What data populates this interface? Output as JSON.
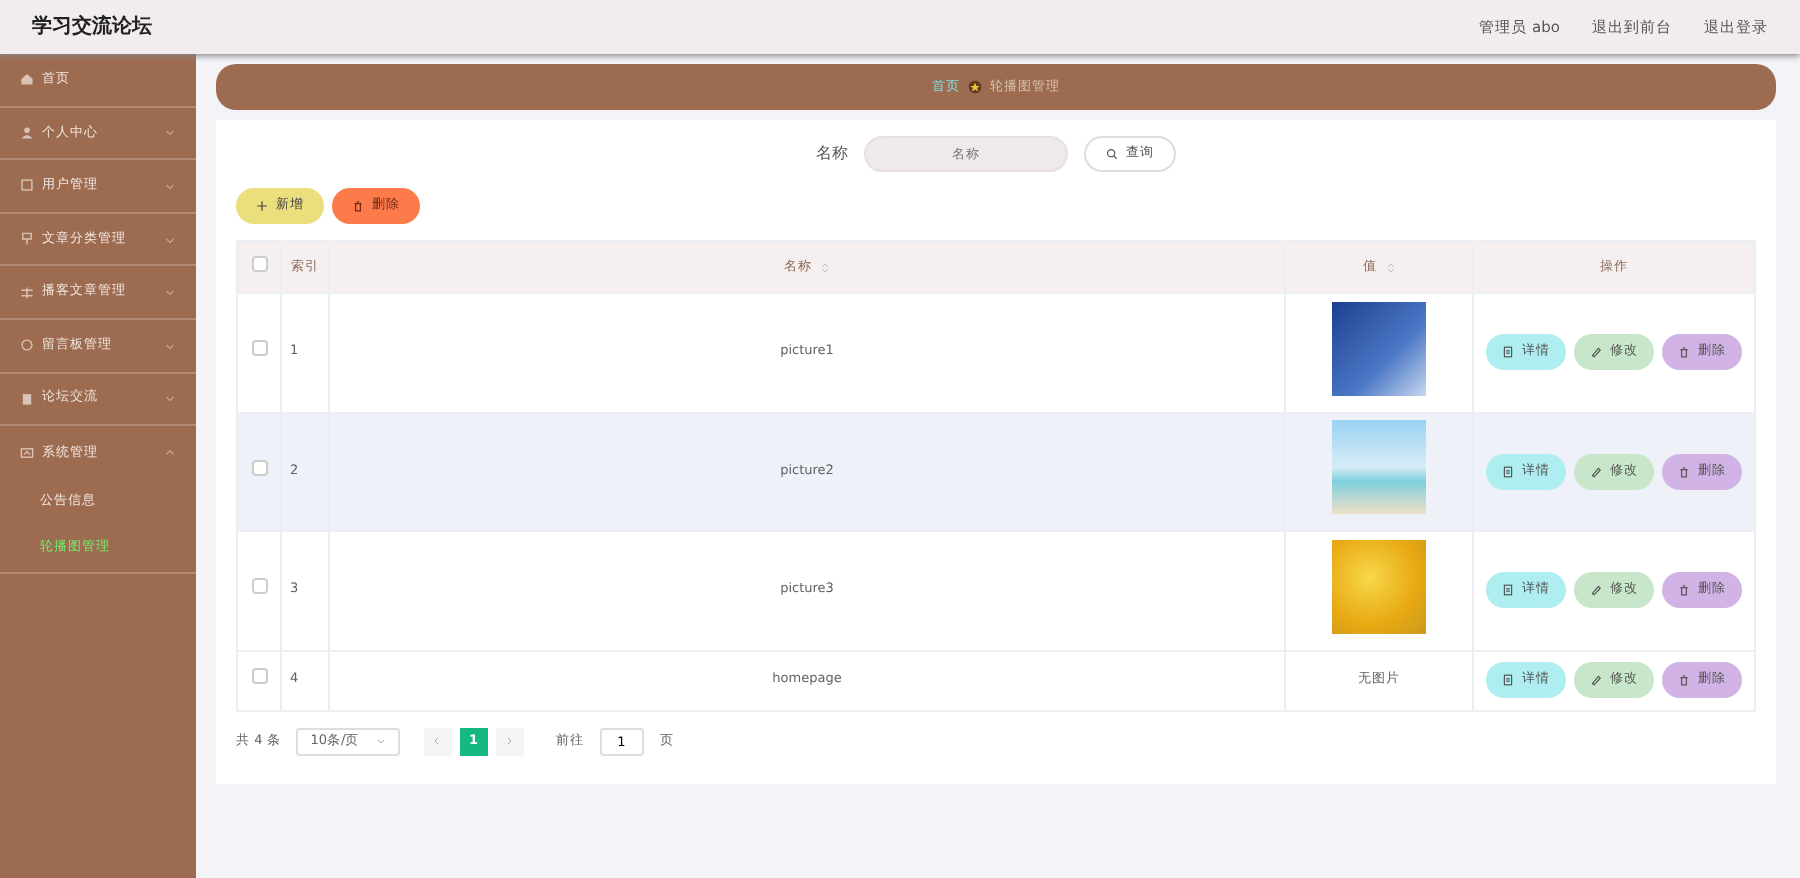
{
  "header": {
    "title": "学习交流论坛",
    "user": "管理员 abo",
    "links": [
      "退出到前台",
      "退出登录"
    ]
  },
  "sidebar": {
    "items": [
      {
        "label": "首页",
        "kind": "link"
      },
      {
        "label": "个人中心",
        "kind": "group",
        "expanded": false
      },
      {
        "label": "用户管理",
        "kind": "group",
        "expanded": false
      },
      {
        "label": "文章分类管理",
        "kind": "group",
        "expanded": false
      },
      {
        "label": "播客文章管理",
        "kind": "group",
        "expanded": false
      },
      {
        "label": "留言板管理",
        "kind": "group",
        "expanded": false
      },
      {
        "label": "论坛交流",
        "kind": "group",
        "expanded": false
      },
      {
        "label": "系统管理",
        "kind": "group",
        "expanded": true,
        "children": [
          {
            "label": "公告信息",
            "selected": false
          },
          {
            "label": "轮播图管理",
            "selected": true
          }
        ]
      }
    ]
  },
  "breadcrumb": [
    "首页",
    "轮播图管理"
  ],
  "search": {
    "label": "名称",
    "placeholder": "名称",
    "button": "查询"
  },
  "actions": [
    "新增",
    "删除"
  ],
  "table": {
    "select_all_checked": false,
    "columns": [
      "索引",
      "名称",
      "值",
      "操作"
    ],
    "rows": [
      {
        "checked": false,
        "hovered": false,
        "index": "1",
        "name": "picture1",
        "value": {
          "kind": "photo"
        },
        "buttons": [
          "详情",
          "修改",
          "删除"
        ]
      },
      {
        "checked": false,
        "hovered": true,
        "index": "2",
        "name": "picture2",
        "value": {
          "kind": "photo"
        },
        "buttons": [
          "详情",
          "修改",
          "删除"
        ]
      },
      {
        "checked": false,
        "hovered": false,
        "index": "3",
        "name": "picture3",
        "value": {
          "kind": "photo"
        },
        "buttons": [
          "详情",
          "修改",
          "删除"
        ]
      },
      {
        "checked": false,
        "hovered": false,
        "index": "4",
        "name": "homepage",
        "value": {
          "kind": "text",
          "text": "无图片"
        },
        "buttons": [
          "详情",
          "修改",
          "删除"
        ]
      }
    ]
  },
  "pagination": {
    "total": "共 4 条",
    "page_size": "10条/页",
    "pages": [
      {
        "label": "1",
        "selected": true
      }
    ],
    "goto": "前往",
    "goto_value": "1",
    "goto_suffix": "页"
  }
}
